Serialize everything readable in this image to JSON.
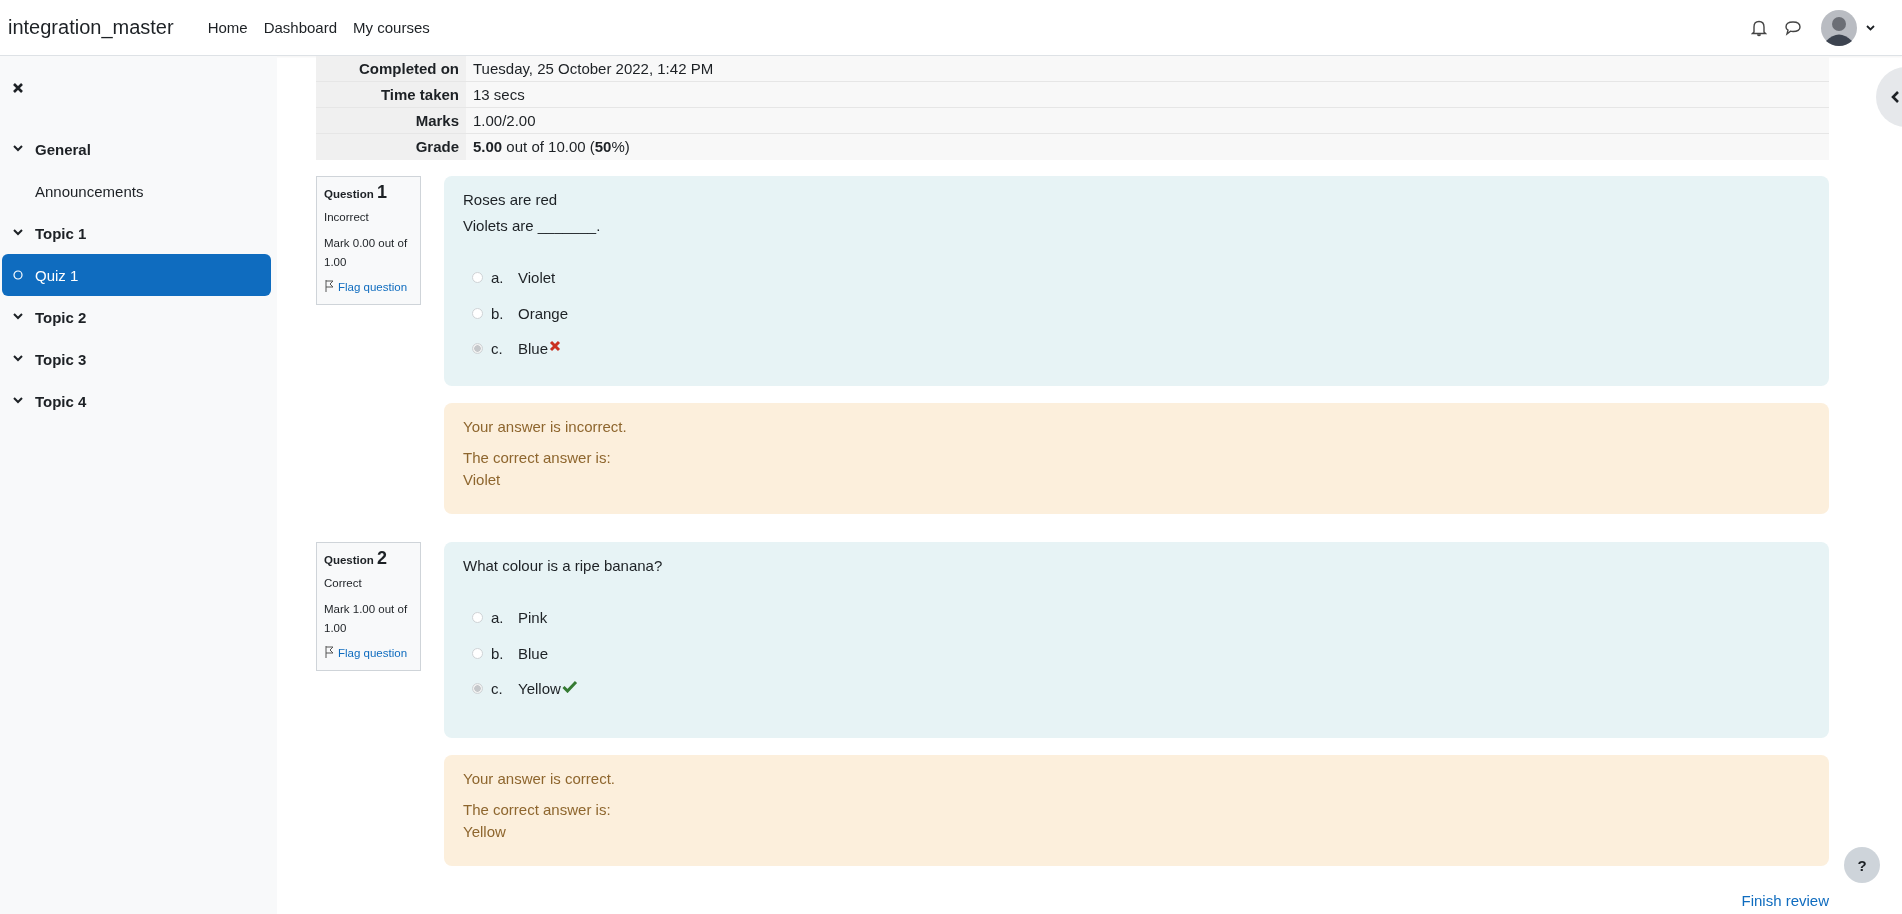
{
  "navbar": {
    "site_name": "integration_master",
    "links": [
      {
        "label": "Home"
      },
      {
        "label": "Dashboard"
      },
      {
        "label": "My courses"
      }
    ]
  },
  "sidebar": {
    "items": [
      {
        "kind": "section",
        "label": "General",
        "expanded": true,
        "selected": false
      },
      {
        "kind": "activity",
        "label": "Announcements",
        "selected": false
      },
      {
        "kind": "section",
        "label": "Topic 1",
        "expanded": true,
        "selected": false
      },
      {
        "kind": "quiz",
        "label": "Quiz 1",
        "selected": true
      },
      {
        "kind": "section",
        "label": "Topic 2",
        "expanded": true,
        "selected": false
      },
      {
        "kind": "section",
        "label": "Topic 3",
        "expanded": true,
        "selected": false
      },
      {
        "kind": "section",
        "label": "Topic 4",
        "expanded": true,
        "selected": false
      }
    ]
  },
  "summary": {
    "rows": [
      {
        "label": "Completed on",
        "value": "Tuesday, 25 October 2022, 1:42 PM"
      },
      {
        "label": "Time taken",
        "value": "13 secs"
      },
      {
        "label": "Marks",
        "value": "1.00/2.00"
      },
      {
        "label": "Grade",
        "value": "**5.00** out of 10.00 (**50**%)"
      }
    ]
  },
  "questions": [
    {
      "label": "Question",
      "number": "1",
      "state": "Incorrect",
      "mark": "Mark 0.00 out of 1.00",
      "flag": "Flag question",
      "text_lines": [
        "Roses are red",
        "Violets are _______."
      ],
      "options": [
        {
          "kind": "plain",
          "letter": "a.",
          "text": "Violet",
          "selected": false
        },
        {
          "kind": "plain",
          "letter": "b.",
          "text": "Orange",
          "selected": false
        },
        {
          "kind": "incorrect",
          "letter": "c.",
          "text": "Blue",
          "selected": true
        }
      ],
      "feedback": {
        "verdict": "Your answer is incorrect.",
        "right_answer_label": "The correct answer is:",
        "right_answer": "Violet"
      }
    },
    {
      "label": "Question",
      "number": "2",
      "state": "Correct",
      "mark": "Mark 1.00 out of 1.00",
      "flag": "Flag question",
      "text_lines": [
        "What colour is a ripe banana?"
      ],
      "options": [
        {
          "kind": "plain",
          "letter": "a.",
          "text": "Pink",
          "selected": false
        },
        {
          "kind": "plain",
          "letter": "b.",
          "text": "Blue",
          "selected": false
        },
        {
          "kind": "correct",
          "letter": "c.",
          "text": "Yellow",
          "selected": true
        }
      ],
      "feedback": {
        "verdict": "Your answer is correct.",
        "right_answer_label": "The correct answer is:",
        "right_answer": "Yellow"
      }
    }
  ],
  "finish_link": "Finish review",
  "help_button": "?"
}
